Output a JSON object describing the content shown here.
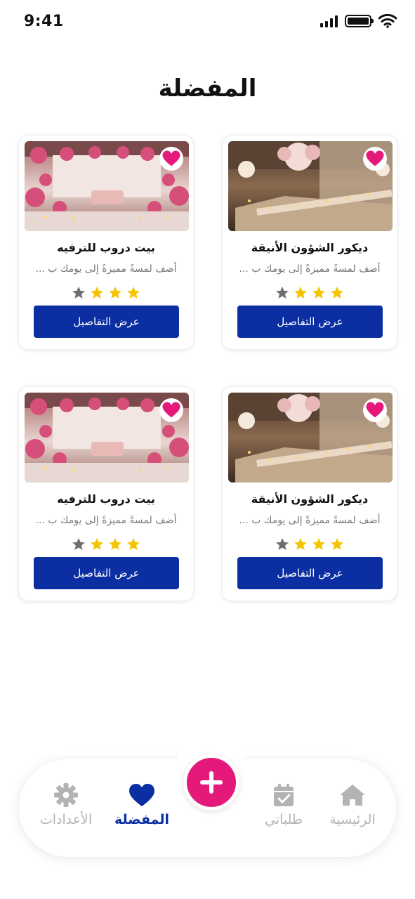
{
  "status": {
    "time": "9:41"
  },
  "page": {
    "title": "المفضلة"
  },
  "cards": [
    {
      "title": "ديكور الشؤون الأنيقة",
      "description": "أضف لمسةً مميزةً إلى يومك ب ...",
      "rating": 3,
      "max_rating": 4,
      "button": "عرض التفاصيل"
    },
    {
      "title": "بيت دروب للترفيه",
      "description": "أضف لمسةً مميزةً إلى يومك ب ...",
      "rating": 3,
      "max_rating": 4,
      "button": "عرض التفاصيل"
    },
    {
      "title": "ديكور الشؤون الأنيقة",
      "description": "أضف لمسةً مميزةً إلى يومك ب ...",
      "rating": 3,
      "max_rating": 4,
      "button": "عرض التفاصيل"
    },
    {
      "title": "بيت دروب للترفيه",
      "description": "أضف لمسةً مميزةً إلى يومك ب ...",
      "rating": 3,
      "max_rating": 4,
      "button": "عرض التفاصيل"
    }
  ],
  "nav": {
    "home": "الرئيسية",
    "orders": "طلباتي",
    "favorites": "المفضلة",
    "settings": "الأعدادات"
  },
  "colors": {
    "primary": "#0b2fa3",
    "accent": "#e5197a",
    "star": "#f5c400",
    "star_empty": "#6e6e6e"
  },
  "icons": {
    "heart": "heart-icon",
    "add": "plus-icon",
    "home": "home-icon",
    "orders": "calendar-check-icon",
    "favorites": "heart-icon",
    "settings": "gear-icon"
  }
}
